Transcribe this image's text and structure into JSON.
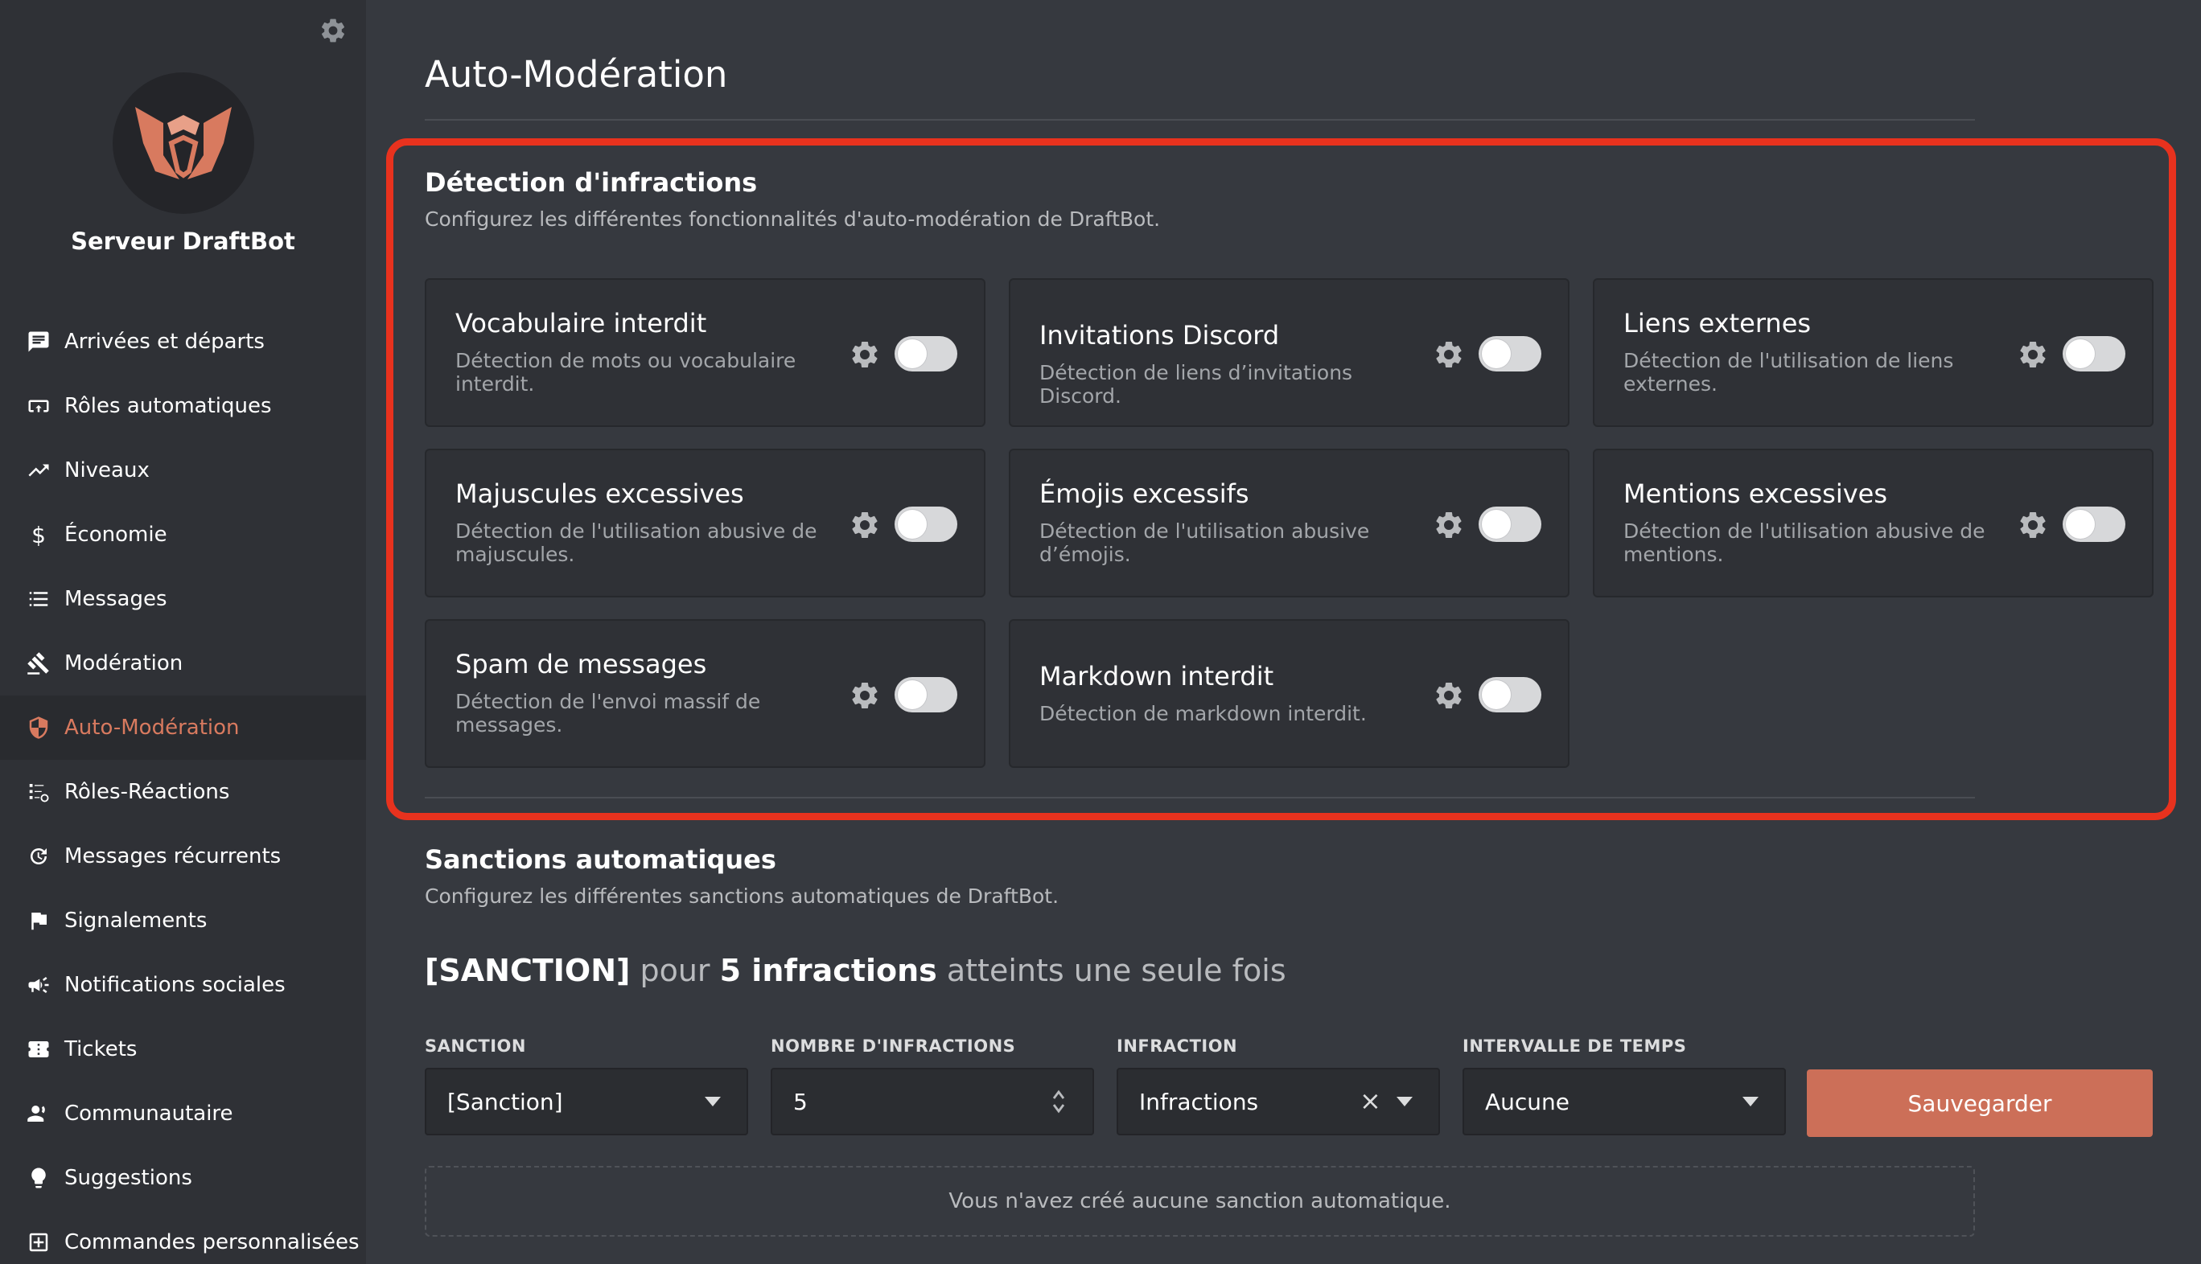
{
  "sidebar": {
    "server_name": "Serveur DraftBot",
    "items": [
      {
        "label": "Arrivées et départs",
        "icon": "chat-icon"
      },
      {
        "label": "Rôles automatiques",
        "icon": "card-icon"
      },
      {
        "label": "Niveaux",
        "icon": "trending-up-icon"
      },
      {
        "label": "Économie",
        "icon": "dollar-icon"
      },
      {
        "label": "Messages",
        "icon": "list-icon"
      },
      {
        "label": "Modération",
        "icon": "gavel-icon"
      },
      {
        "label": "Auto-Modération",
        "icon": "shield-icon",
        "active": true
      },
      {
        "label": "Rôles-Réactions",
        "icon": "roles-list-icon"
      },
      {
        "label": "Messages récurrents",
        "icon": "repeat-icon"
      },
      {
        "label": "Signalements",
        "icon": "flag-icon"
      },
      {
        "label": "Notifications sociales",
        "icon": "megaphone-icon"
      },
      {
        "label": "Tickets",
        "icon": "ticket-icon"
      },
      {
        "label": "Communautaire",
        "icon": "users-icon"
      },
      {
        "label": "Suggestions",
        "icon": "lightbulb-icon"
      },
      {
        "label": "Commandes personnalisées",
        "icon": "add-box-icon"
      }
    ]
  },
  "main": {
    "title": "Auto-Modération",
    "detection": {
      "title": "Détection d'infractions",
      "subtitle": "Configurez les différentes fonctionnalités d'auto-modération de DraftBot.",
      "cards": [
        {
          "title": "Vocabulaire interdit",
          "desc": "Détection de mots ou vocabulaire interdit.",
          "enabled": false
        },
        {
          "title": "Invitations Discord",
          "desc": "Détection de liens d’invitations Discord.",
          "enabled": false
        },
        {
          "title": "Liens externes",
          "desc": "Détection de l'utilisation de liens externes.",
          "enabled": false
        },
        {
          "title": "Majuscules excessives",
          "desc": "Détection de l'utilisation abusive de majuscules.",
          "enabled": false
        },
        {
          "title": "Émojis excessifs",
          "desc": "Détection de l'utilisation abusive d’émojis.",
          "enabled": false
        },
        {
          "title": "Mentions excessives",
          "desc": "Détection de l'utilisation abusive de mentions.",
          "enabled": false
        },
        {
          "title": "Spam de messages",
          "desc": "Détection de l'envoi massif de messages.",
          "enabled": false
        },
        {
          "title": "Markdown interdit",
          "desc": "Détection de markdown interdit.",
          "enabled": false
        }
      ]
    },
    "sanctions": {
      "title": "Sanctions automatiques",
      "subtitle": "Configurez les différentes sanctions automatiques de DraftBot.",
      "summary_sanction": "[SANCTION]",
      "summary_pour": " pour ",
      "summary_count": "5 infractions",
      "summary_rest": " atteints une seule fois",
      "fields": {
        "sanction_label": "SANCTION",
        "sanction_value": "[Sanction]",
        "count_label": "NOMBRE D'INFRACTIONS",
        "count_value": "5",
        "infraction_label": "INFRACTION",
        "infraction_value": "Infractions",
        "interval_label": "INTERVALLE DE TEMPS",
        "interval_value": "Aucune"
      },
      "save_label": "Sauvegarder",
      "empty_message": "Vous n'avez créé aucune sanction automatique."
    }
  },
  "colors": {
    "accent": "#d87a5f",
    "save_button": "#cc6f58",
    "highlight_border": "#e8321e"
  }
}
